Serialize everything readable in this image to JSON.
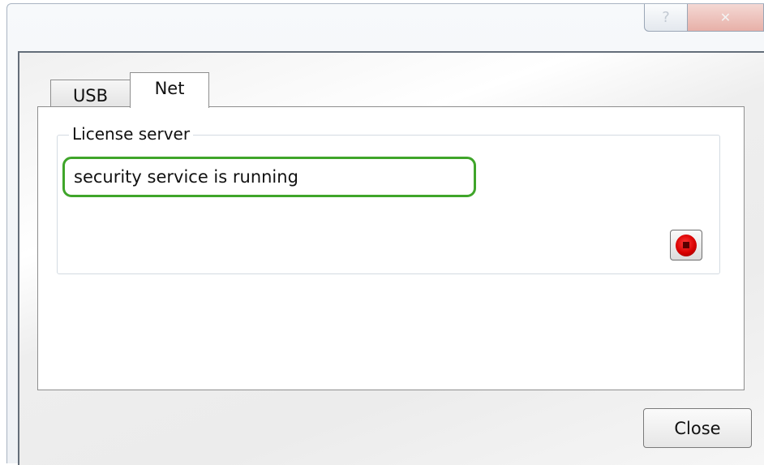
{
  "titlebar": {
    "help_glyph": "?",
    "close_glyph": "✕"
  },
  "tabs": [
    {
      "label": "USB",
      "selected": false
    },
    {
      "label": "Net",
      "selected": true
    }
  ],
  "license_server": {
    "group_label": "License server",
    "status_text": "security service is running",
    "status_highlight_color": "#3fa52a",
    "stop_icon": "stop-record-icon",
    "stop_color": "#d80000"
  },
  "footer": {
    "close_label": "Close"
  }
}
